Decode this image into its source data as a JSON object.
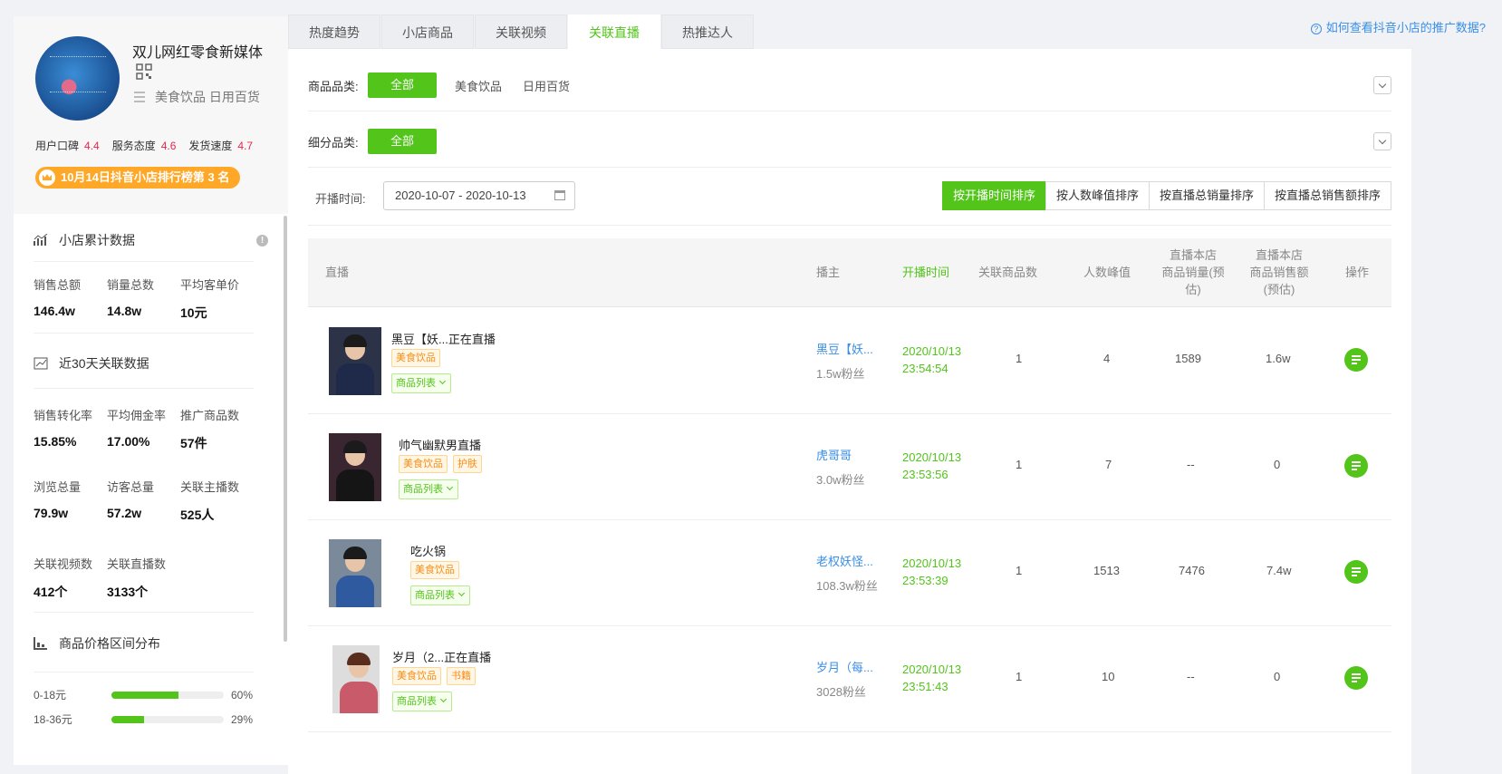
{
  "shop": {
    "name": "双儿网红零食新媒体",
    "categories": "美食饮品 日用百货",
    "ratings": [
      {
        "label": "用户口碑",
        "value": "4.4"
      },
      {
        "label": "服务态度",
        "value": "4.6"
      },
      {
        "label": "发货速度",
        "value": "4.7"
      }
    ],
    "rank_badge": "10月14日抖音小店排行榜第 3 名"
  },
  "cumulative": {
    "title": "小店累计数据",
    "stats": [
      {
        "label": "销售总额",
        "value": "146.4w"
      },
      {
        "label": "销量总数",
        "value": "14.8w"
      },
      {
        "label": "平均客单价",
        "value": "10元"
      }
    ]
  },
  "recent30": {
    "title": "近30天关联数据",
    "rows": [
      [
        {
          "label": "销售转化率",
          "value": "15.85%"
        },
        {
          "label": "平均佣金率",
          "value": "17.00%"
        },
        {
          "label": "推广商品数",
          "value": "57件"
        }
      ],
      [
        {
          "label": "浏览总量",
          "value": "79.9w"
        },
        {
          "label": "访客总量",
          "value": "57.2w"
        },
        {
          "label": "关联主播数",
          "value": "525人"
        }
      ],
      [
        {
          "label": "关联视频数",
          "value": "412个"
        },
        {
          "label": "关联直播数",
          "value": "3133个"
        }
      ]
    ]
  },
  "price_dist": {
    "title": "商品价格区间分布",
    "rows": [
      {
        "range": "0-18元",
        "pct": 60,
        "pct_label": "60%"
      },
      {
        "range": "18-36元",
        "pct": 29,
        "pct_label": "29%"
      }
    ]
  },
  "tabs": [
    "热度趋势",
    "小店商品",
    "关联视频",
    "关联直播",
    "热推达人"
  ],
  "active_tab": 3,
  "help_link": "如何查看抖音小店的推广数据?",
  "filters": {
    "category_label": "商品品类:",
    "category_all": "全部",
    "category_options": [
      "美食饮品",
      "日用百货"
    ],
    "subcategory_label": "细分品类:",
    "subcategory_all": "全部",
    "date_label": "开播时间:",
    "date_range": "2020-10-07 - 2020-10-13"
  },
  "sort_buttons": [
    "按开播时间排序",
    "按人数峰值排序",
    "按直播总销量排序",
    "按直播总销售额排序"
  ],
  "table": {
    "headers": {
      "live": "直播",
      "anchor": "播主",
      "start_time": "开播时间",
      "products": "关联商品数",
      "peak": "人数峰值",
      "sales_l1": "直播本店",
      "sales_l2": "商品销量(预",
      "sales_l3": "估)",
      "amount_l1": "直播本店",
      "amount_l2": "商品销售额",
      "amount_l3": "(预估)",
      "op": "操作"
    },
    "product_list_label": "商品列表",
    "rows": [
      {
        "title": "黑豆【妖...正在直播",
        "tags": [
          "美食饮品"
        ],
        "anchor": "黑豆【妖...",
        "fans": "1.5w粉丝",
        "date": "2020/10/13",
        "time": "23:54:54",
        "products": "1",
        "peak": "4",
        "sales": "1589",
        "amount": "1.6w"
      },
      {
        "title": "帅气幽默男直播",
        "tags": [
          "美食饮品",
          "护肤"
        ],
        "anchor": "虎哥哥",
        "fans": "3.0w粉丝",
        "date": "2020/10/13",
        "time": "23:53:56",
        "products": "1",
        "peak": "7",
        "sales": "--",
        "amount": "0"
      },
      {
        "title": "吃火锅",
        "tags": [
          "美食饮品"
        ],
        "anchor": "老权妖怪...",
        "fans": "108.3w粉丝",
        "date": "2020/10/13",
        "time": "23:53:39",
        "products": "1",
        "peak": "1513",
        "sales": "7476",
        "amount": "7.4w"
      },
      {
        "title": "岁月（2...正在直播",
        "tags": [
          "美食饮品",
          "书籍"
        ],
        "anchor": "岁月（每...",
        "fans": "3028粉丝",
        "date": "2020/10/13",
        "time": "23:51:43",
        "products": "1",
        "peak": "10",
        "sales": "--",
        "amount": "0"
      }
    ]
  },
  "colors": {
    "accent": "#52c41a",
    "link": "#3a8ee6",
    "rating": "#e6264d",
    "badge": "#ffa726"
  }
}
